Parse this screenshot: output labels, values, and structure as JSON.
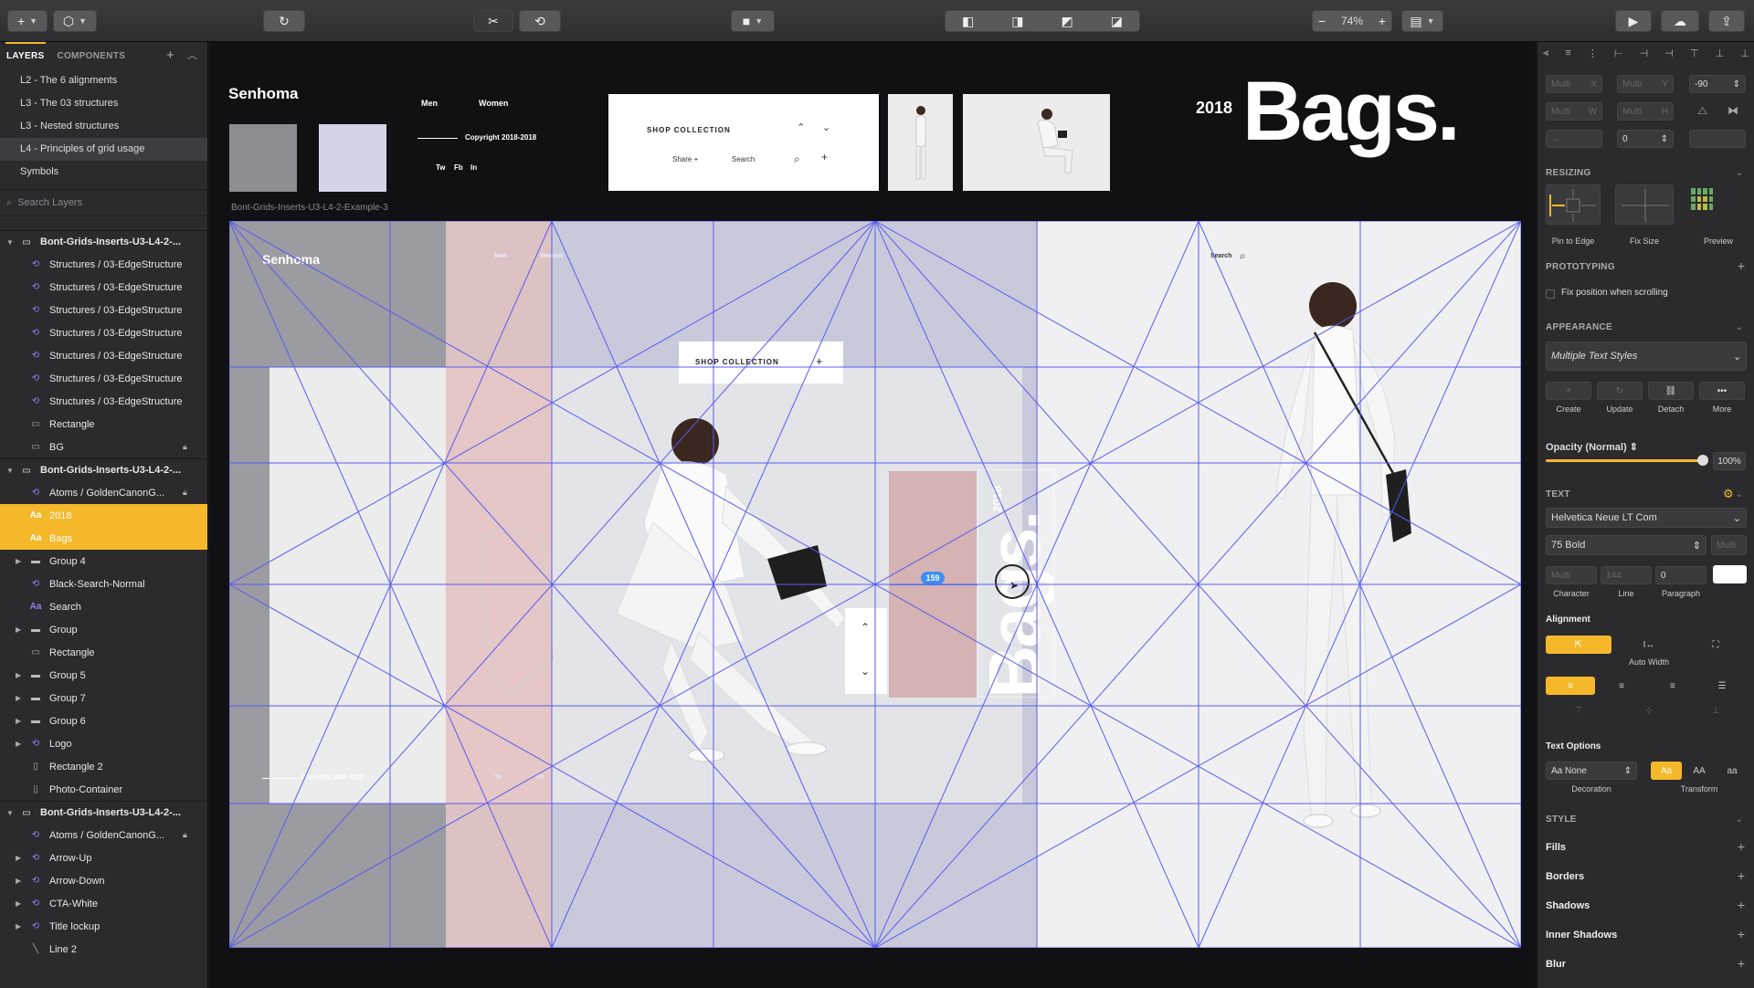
{
  "toolbar": {
    "insert": "+",
    "create_symbol": "⬡",
    "zoom_value": "74%",
    "zoom_minus": "−",
    "zoom_plus": "+"
  },
  "left_panel": {
    "tabs": [
      "LAYERS",
      "COMPONENTS"
    ],
    "pages": [
      "L2 - The 6 alignments",
      "L3 - The 03 structures",
      "L3 - Nested structures",
      "L4 - Principles of grid usage",
      "Symbols"
    ],
    "search_placeholder": "Search Layers",
    "layers": [
      "Bont-Grids-Inserts-U3-L4-2-...",
      "Structures / 03-EdgeStructure",
      "Structures / 03-EdgeStructure",
      "Structures / 03-EdgeStructure",
      "Structures / 03-EdgeStructure",
      "Structures / 03-EdgeStructure",
      "Structures / 03-EdgeStructure",
      "Structures / 03-EdgeStructure",
      "Rectangle",
      "BG",
      "Bont-Grids-Inserts-U3-L4-2-...",
      "Atoms / GoldenCanonG...",
      "2018",
      "Bags",
      "Group 4",
      "Black-Search-Normal",
      "Search",
      "Group",
      "Rectangle",
      "Group 5",
      "Group 7",
      "Group 6",
      "Logo",
      "Rectangle 2",
      "Photo-Container",
      "Bont-Grids-Inserts-U3-L4-2-...",
      "Atoms / GoldenCanonG...",
      "Arrow-Up",
      "Arrow-Down",
      "CTA-White",
      "Title lockup",
      "Line 2"
    ]
  },
  "canvas": {
    "top_logo": "Senhoma",
    "nav_men": "Men",
    "nav_women": "Women",
    "copyright": "Copyright 2018-2018",
    "social": [
      "Tw",
      "Fb",
      "In"
    ],
    "shop_collection": "SHOP COLLECTION",
    "share": "Share +",
    "search": "Search",
    "year": "2018",
    "bags": "Bags.",
    "artboard_label": "Bont-Grids-Inserts-U3-L4-2-Example-3",
    "ab_logo": "Senhoma",
    "ab_men": "Men",
    "ab_women": "Women",
    "ab_search": "Search",
    "ab_shop": "SHOP COLLECTION",
    "ab_year": "2018",
    "ab_bags": "Bags.",
    "ab_copyright": "Copyright 2018-2018",
    "ab_social": [
      "Tw",
      "Fb",
      "In"
    ],
    "measure_badge": "159"
  },
  "right_panel": {
    "x_placeholder": "Multi",
    "y_placeholder": "Multi",
    "rotation": "-90",
    "w_placeholder": "Multi",
    "h_placeholder": "Multi",
    "radius_value": "0",
    "resizing_title": "RESIZING",
    "pin_to_edge": "Pin to Edge",
    "fix_size": "Fix Size",
    "preview": "Preview",
    "prototyping_title": "PROTOTYPING",
    "fix_position": "Fix position when scrolling",
    "appearance_title": "APPEARANCE",
    "text_style": "Multiple Text Styles",
    "style_actions": [
      "Create",
      "Update",
      "Detach",
      "More"
    ],
    "opacity_label": "Opacity (Normal)",
    "opacity_value": "100%",
    "text_title": "TEXT",
    "font_family": "Helvetica Neue LT Com",
    "font_weight": "75 Bold",
    "size_placeholder": "Multi",
    "character_placeholder": "Multi",
    "line_placeholder": "144",
    "paragraph_value": "0",
    "character_label": "Character",
    "line_label": "Line",
    "paragraph_label": "Paragraph",
    "alignment_title": "Alignment",
    "auto_width": "Auto Width",
    "text_options_title": "Text Options",
    "decoration_value": "Aa None",
    "decoration_label": "Decoration",
    "transform_label": "Transform",
    "transform_options": [
      "Aa",
      "AA",
      "aa"
    ],
    "style_title": "STYLE",
    "style_rows": [
      "Fills",
      "Borders",
      "Shadows",
      "Inner Shadows",
      "Blur"
    ]
  },
  "colors": {
    "accent": "#f5b82b",
    "grid_line": "#5a5af0",
    "column_pink": "#e8c4c0",
    "column_blue": "#c9cce0",
    "badge": "#3a8ef6"
  }
}
